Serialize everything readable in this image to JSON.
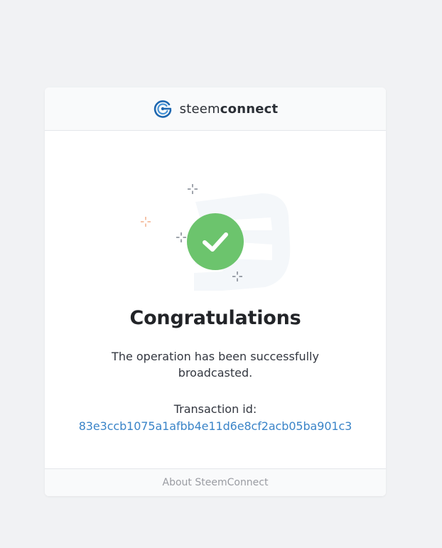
{
  "header": {
    "brand_light": "steem",
    "brand_bold": "connect"
  },
  "main": {
    "title": "Congratulations",
    "message": "The operation has been successfully broadcasted.",
    "transaction_label": "Transaction id:",
    "transaction_id": "83e3ccb1075a1afbb4e11d6e8cf2acb05ba901c3"
  },
  "footer": {
    "link_label": "About SteemConnect"
  },
  "colors": {
    "page_background": "#f1f2f4",
    "brand_blue": "#1e67b0",
    "success_green": "#6cc46d",
    "link_blue": "#3a84c8",
    "sparkle_orange": "#f0a37b",
    "sparkle_gray": "#6b7280"
  },
  "icons": {
    "brand": "steemconnect-logo-icon",
    "status": "checkmark-icon"
  }
}
